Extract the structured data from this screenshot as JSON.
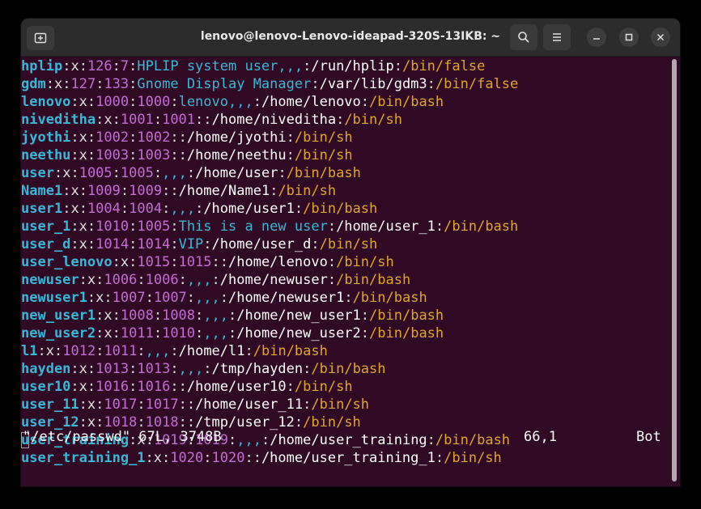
{
  "window": {
    "title": "lenovo@lenovo-Lenovo-ideapad-320S-13IKB: ~"
  },
  "colors": {
    "background": "#300a24",
    "username": "#39b7d6",
    "number": "#c36cd6",
    "shell": "#e0a526",
    "path": "#ffffff"
  },
  "icons": {
    "new_tab": "new-tab-icon",
    "search": "search-icon",
    "menu": "hamburger-menu-icon",
    "minimize": "minimize-icon",
    "maximize": "maximize-icon",
    "close": "close-icon"
  },
  "lines": [
    {
      "user": "hplip",
      "x": "x",
      "uid": "126",
      "gid": "7",
      "gecos": "HPLIP system user,,,",
      "home": "/run/hplip",
      "shell": "/bin/false"
    },
    {
      "user": "gdm",
      "x": "x",
      "uid": "127",
      "gid": "133",
      "gecos": "Gnome Display Manager",
      "home": "/var/lib/gdm3",
      "shell": "/bin/false"
    },
    {
      "user": "lenovo",
      "x": "x",
      "uid": "1000",
      "gid": "1000",
      "gecos": "lenovo,,,",
      "home": "/home/lenovo",
      "shell": "/bin/bash"
    },
    {
      "user": "niveditha",
      "x": "x",
      "uid": "1001",
      "gid": "1001",
      "gecos": "",
      "home": "/home/niveditha",
      "shell": "/bin/sh"
    },
    {
      "user": "jyothi",
      "x": "x",
      "uid": "1002",
      "gid": "1002",
      "gecos": "",
      "home": "/home/jyothi",
      "shell": "/bin/sh"
    },
    {
      "user": "neethu",
      "x": "x",
      "uid": "1003",
      "gid": "1003",
      "gecos": "",
      "home": "/home/neethu",
      "shell": "/bin/sh"
    },
    {
      "user": "user",
      "x": "x",
      "uid": "1005",
      "gid": "1005",
      "gecos": ",,,",
      "home": "/home/user",
      "shell": "/bin/bash"
    },
    {
      "user": "Name1",
      "x": "x",
      "uid": "1009",
      "gid": "1009",
      "gecos": "",
      "home": "/home/Name1",
      "shell": "/bin/sh"
    },
    {
      "user": "user1",
      "x": "x",
      "uid": "1004",
      "gid": "1004",
      "gecos": ",,,",
      "home": "/home/user1",
      "shell": "/bin/bash"
    },
    {
      "user": "user_1",
      "x": "x",
      "uid": "1010",
      "gid": "1005",
      "gecos": "This is a new user",
      "home": "/home/user_1",
      "shell": "/bin/bash"
    },
    {
      "user": "user_d",
      "x": "x",
      "uid": "1014",
      "gid": "1014",
      "gecos": "VIP",
      "home": "/home/user_d",
      "shell": "/bin/sh"
    },
    {
      "user": "user_lenovo",
      "x": "x",
      "uid": "1015",
      "gid": "1015",
      "gecos": "",
      "home": "/home/lenovo",
      "shell": "/bin/sh"
    },
    {
      "user": "newuser",
      "x": "x",
      "uid": "1006",
      "gid": "1006",
      "gecos": ",,,",
      "home": "/home/newuser",
      "shell": "/bin/bash"
    },
    {
      "user": "newuser1",
      "x": "x",
      "uid": "1007",
      "gid": "1007",
      "gecos": ",,,",
      "home": "/home/newuser1",
      "shell": "/bin/bash"
    },
    {
      "user": "new_user1",
      "x": "x",
      "uid": "1008",
      "gid": "1008",
      "gecos": ",,,",
      "home": "/home/new_user1",
      "shell": "/bin/bash"
    },
    {
      "user": "new_user2",
      "x": "x",
      "uid": "1011",
      "gid": "1010",
      "gecos": ",,,",
      "home": "/home/new_user2",
      "shell": "/bin/bash"
    },
    {
      "user": "l1",
      "x": "x",
      "uid": "1012",
      "gid": "1011",
      "gecos": ",,,",
      "home": "/home/l1",
      "shell": "/bin/bash"
    },
    {
      "user": "hayden",
      "x": "x",
      "uid": "1013",
      "gid": "1013",
      "gecos": ",,,",
      "home": "/tmp/hayden",
      "shell": "/bin/bash"
    },
    {
      "user": "user10",
      "x": "x",
      "uid": "1016",
      "gid": "1016",
      "gecos": "",
      "home": "/home/user10",
      "shell": "/bin/sh"
    },
    {
      "user": "user_11",
      "x": "x",
      "uid": "1017",
      "gid": "1017",
      "gecos": "",
      "home": "/home/user_11",
      "shell": "/bin/sh"
    },
    {
      "user": "user_12",
      "x": "x",
      "uid": "1018",
      "gid": "1018",
      "gecos": "",
      "home": "/tmp/user_12",
      "shell": "/bin/sh"
    },
    {
      "user": "user_training",
      "x": "x",
      "uid": "1019",
      "gid": "1019",
      "gecos": ",,,",
      "home": "/home/user_training",
      "shell": "/bin/bash"
    },
    {
      "user": "user_training_1",
      "x": "x",
      "uid": "1020",
      "gid": "1020",
      "gecos": "",
      "home": "/home/user_training_1",
      "shell": "/bin/sh"
    }
  ],
  "status": {
    "file_info": "\"/etc/passwd\" 67L, 3748B",
    "position": "66,1",
    "scroll": "Bot"
  }
}
